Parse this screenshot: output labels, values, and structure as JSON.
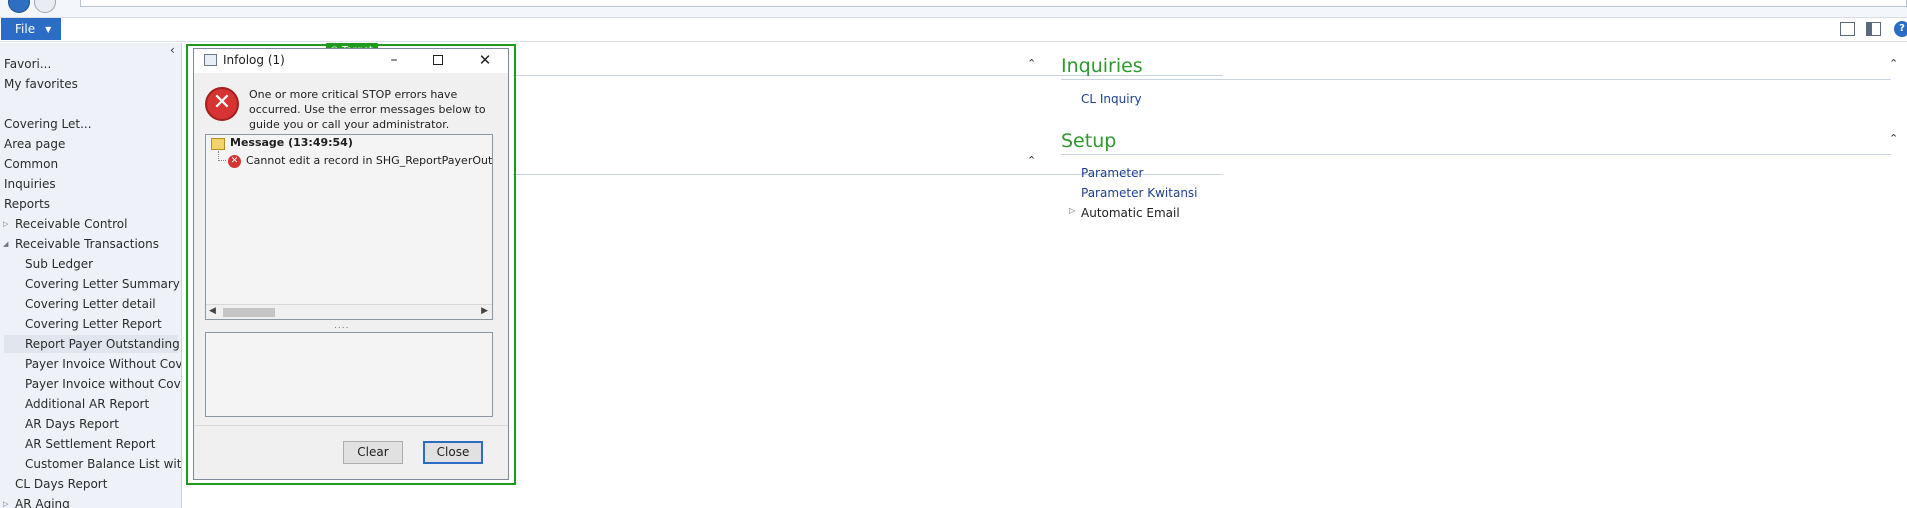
{
  "ribbon": {
    "file_label": "File"
  },
  "nav": {
    "items": [
      {
        "label": "Favori..."
      },
      {
        "label": "My favorites"
      },
      {
        "label": "Covering Let..."
      },
      {
        "label": "Area page"
      },
      {
        "label": "Common"
      },
      {
        "label": "Inquiries"
      },
      {
        "label": "Reports"
      },
      {
        "label": "Receivable Control"
      },
      {
        "label": "Receivable Transactions"
      },
      {
        "label": "Sub Ledger"
      },
      {
        "label": "Covering Letter Summary"
      },
      {
        "label": "Covering Letter detail"
      },
      {
        "label": "Covering Letter Report"
      },
      {
        "label": "Report Payer Outstanding"
      },
      {
        "label": "Payer Invoice Without Cov..."
      },
      {
        "label": "Payer Invoice without Cov..."
      },
      {
        "label": "Additional AR Report"
      },
      {
        "label": "AR Days Report"
      },
      {
        "label": "AR Settlement Report"
      },
      {
        "label": "Customer Balance List with..."
      },
      {
        "label": "CL Days Report"
      },
      {
        "label": "AR Aging"
      }
    ]
  },
  "content": {
    "inquiries": {
      "title": "Inquiries",
      "links": [
        "CL Inquiry"
      ]
    },
    "setup": {
      "title": "Setup",
      "links": [
        "Parameter",
        "Parameter Kwitansi",
        "Automatic Email"
      ]
    }
  },
  "dialog": {
    "badge": "Target",
    "title": "Infolog (1)",
    "error_text": "One or more critical STOP errors have occurred. Use the error messages below to guide you or call your administrator.",
    "tree": {
      "message_label": "Message (13:49:54)",
      "error_label": "Cannot edit a record in SHG_ReportPayerOutstanding"
    },
    "splitter": "....",
    "clear_label": "Clear",
    "close_label": "Close"
  },
  "colors": {
    "accent": "#2b6cc4",
    "section_title": "#2d9a2d",
    "target_frame": "#1f9a1f",
    "error": "#d63333"
  }
}
